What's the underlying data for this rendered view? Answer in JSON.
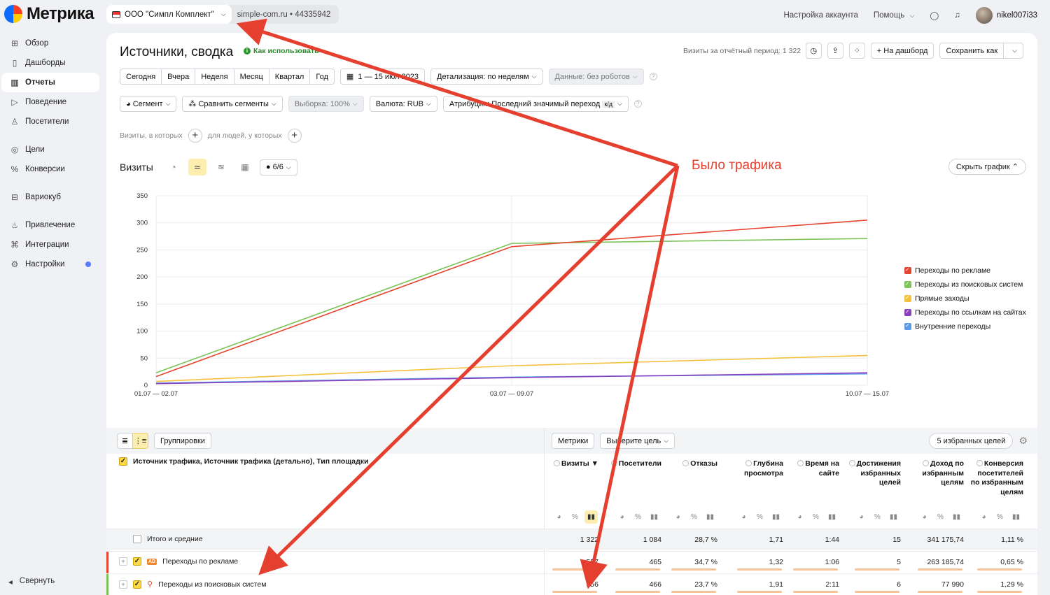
{
  "app": {
    "logo_text": "Метрика"
  },
  "sidebar": {
    "items": [
      {
        "label": "Обзор",
        "icon": "grid-icon"
      },
      {
        "label": "Дашборды",
        "icon": "dashboard-icon"
      },
      {
        "label": "Отчеты",
        "icon": "reports-icon",
        "active": true
      },
      {
        "label": "Поведение",
        "icon": "play-icon"
      },
      {
        "label": "Посетители",
        "icon": "person-icon"
      },
      {
        "label": "Цели",
        "icon": "target-icon"
      },
      {
        "label": "Конверсии",
        "icon": "percent-icon"
      },
      {
        "label": "Вариокуб",
        "icon": "cube-icon"
      },
      {
        "label": "Привлечение",
        "icon": "flame-icon"
      },
      {
        "label": "Интеграции",
        "icon": "plug-icon"
      },
      {
        "label": "Настройки",
        "icon": "gear-icon"
      }
    ],
    "collapse_label": "Свернуть"
  },
  "topbar": {
    "org": "ООО \"Симпл Комплект\"",
    "site": "simple-com.ru",
    "counter_id": "44335942",
    "account_settings": "Настройка аккаунта",
    "help": "Помощь",
    "username": "nikel007i33"
  },
  "report": {
    "title": "Источники, сводка",
    "howto": "Как использовать",
    "visits_period": "Визиты за отчётный период: 1 322",
    "to_dashboard": "На дашборд",
    "save_as": "Сохранить как",
    "periods": [
      "Сегодня",
      "Вчера",
      "Неделя",
      "Месяц",
      "Квартал",
      "Год"
    ],
    "date_range": "1 — 15 июл 2023",
    "detail": "Детализация: по неделям",
    "data_filter": "Данные: без роботов",
    "segment": "Сегмент",
    "compare": "Сравнить сегменты",
    "sample": "Выборка: 100%",
    "currency": "Валюта: RUB",
    "attribution": "Атрибуция: Последний значимый переход",
    "attribution_badge": "к/д",
    "cond_visits": "Визиты, в которых",
    "cond_people": "для людей, у которых",
    "chart_label": "Визиты",
    "series_count": "6/6",
    "hide_chart": "Скрыть график"
  },
  "chart_data": {
    "type": "line",
    "x": [
      "01.07 — 02.07",
      "03.07 — 09.07",
      "10.07 — 15.07"
    ],
    "ylim": [
      0,
      350
    ],
    "yticks": [
      0,
      50,
      100,
      150,
      200,
      250,
      300,
      350
    ],
    "grid": true,
    "legend_position": "right",
    "series": [
      {
        "name": "Переходы по рекламе",
        "color": "#e5452f",
        "values": [
          16,
          256,
          305
        ]
      },
      {
        "name": "Переходы из поисковых систем",
        "color": "#7cc35a",
        "values": [
          23,
          262,
          271
        ]
      },
      {
        "name": "Прямые заходы",
        "color": "#f5c23c",
        "values": [
          7,
          36,
          55
        ]
      },
      {
        "name": "Переходы по ссылкам на сайтах",
        "color": "#8b3fc1",
        "values": [
          3,
          14,
          23
        ]
      },
      {
        "name": "Внутренние переходы",
        "color": "#5b9ae8",
        "values": [
          4,
          15,
          21
        ]
      }
    ]
  },
  "table": {
    "group_btn": "Группировки",
    "metrics_btn": "Метрики",
    "goal_btn": "Выберите цель",
    "fav_goals": "5 избранных целей",
    "dimension_header": "Источник трафика, Источник трафика (детально), Тип площадки",
    "columns": [
      {
        "label": "Визиты ▼"
      },
      {
        "label": "Посетители"
      },
      {
        "label": "Отказы"
      },
      {
        "label": "Глубина просмотра"
      },
      {
        "label": "Время на сайте"
      },
      {
        "label": "Достижения избранных целей"
      },
      {
        "label": "Доход по избранным целям"
      },
      {
        "label": "Конверсия посетителей по избранным целям"
      }
    ],
    "total": {
      "label": "Итого и средние",
      "values": [
        "1 322",
        "1 084",
        "28,7 %",
        "1,71",
        "1:44",
        "15",
        "341 175,74",
        "1,11 %"
      ]
    },
    "rows": [
      {
        "label": "Переходы по рекламе",
        "color": "#e5452f",
        "values": [
          "557",
          "465",
          "34,7 %",
          "1,32",
          "1:06",
          "5",
          "263 185,74",
          "0,65 %"
        ]
      },
      {
        "label": "Переходы из поисковых систем",
        "color": "#7cc35a",
        "values": [
          "556",
          "466",
          "23,7 %",
          "1,91",
          "2:11",
          "6",
          "77 990",
          "1,29 %"
        ]
      }
    ]
  },
  "annotation": {
    "text": "Было трафика",
    "color": "#e5402f"
  }
}
